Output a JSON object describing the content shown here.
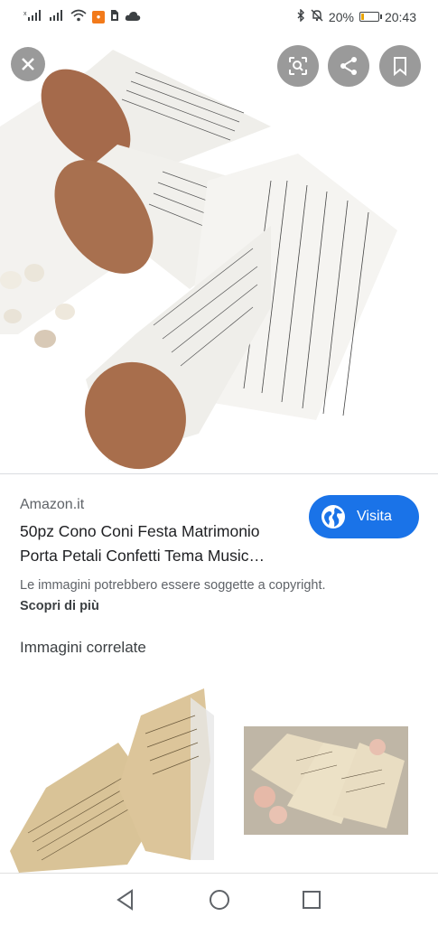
{
  "status_bar": {
    "battery_percent": "20%",
    "battery_level": 0.2,
    "time": "20:43",
    "icons": [
      "signal-icon",
      "signal-icon",
      "wifi-icon",
      "notification-icon",
      "sim-icon",
      "cloud-icon",
      "bluetooth-icon",
      "mute-icon",
      "battery-icon"
    ]
  },
  "hero": {
    "image_icons": [
      "close-icon",
      "lens-icon",
      "share-icon",
      "bookmark-icon"
    ]
  },
  "result": {
    "source": "Amazon.it",
    "title_line1": "50pz Cono Coni Festa Matrimonio",
    "title_line2": "Porta Petali Confetti Tema Music…",
    "visit_label": "Visita",
    "copyright_notice": "Le immagini potrebbero essere soggette a copyright.",
    "learn_more": "Scopri di più"
  },
  "related": {
    "heading": "Immagini correlate"
  },
  "colors": {
    "accent": "#1a73e8",
    "cone_brown": "#a0684a",
    "paper": "#f4f4f2"
  }
}
